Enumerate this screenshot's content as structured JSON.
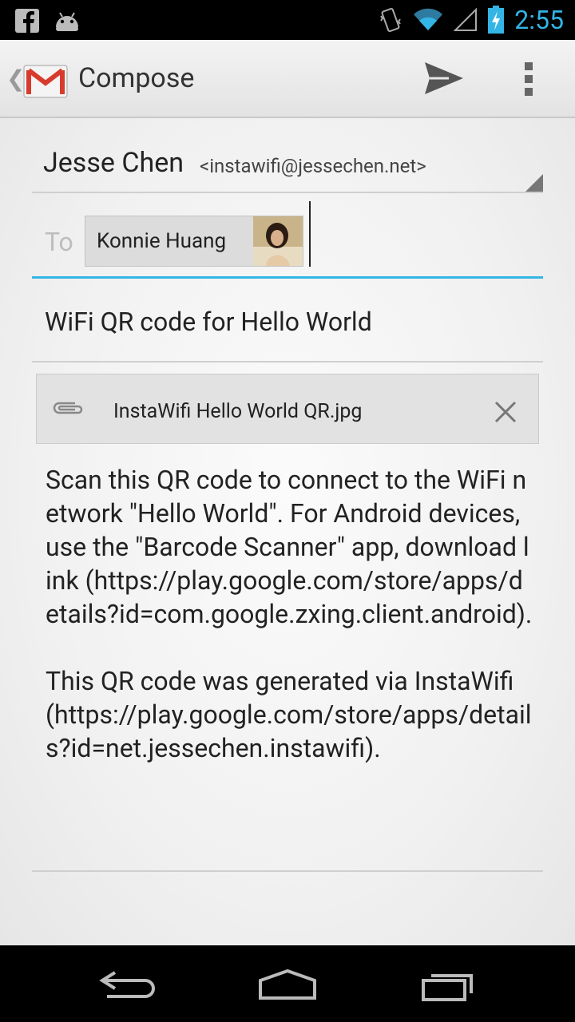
{
  "status_bar": {
    "left_icons": [
      "facebook-icon",
      "android-debug-icon"
    ],
    "right_icons": [
      "vibrate-icon",
      "wifi-icon",
      "signal-icon",
      "battery-charging-icon"
    ],
    "time": "2:55"
  },
  "action_bar": {
    "app_icon": "gmail-icon",
    "title": "Compose",
    "actions": [
      "send-icon",
      "overflow-menu-icon"
    ]
  },
  "compose": {
    "from_name": "Jesse Chen",
    "from_address": "<instawifi@jessechen.net>",
    "to_label": "To",
    "recipient_name": "Konnie Huang",
    "subject": "WiFi QR code for Hello World",
    "attachment_name": "InstaWifi Hello World QR.jpg",
    "body": "Scan this QR code to connect to the WiFi network \"Hello World\". For Android devices, use the \"Barcode Scanner\" app, download link (https://play.google.com/store/apps/details?id=com.google.zxing.client.android).\n\nThis QR code was generated via InstaWifi (https://play.google.com/store/apps/details?id=net.jessechen.instawifi)."
  },
  "colors": {
    "accent": "#33b5e5",
    "gmail_red": "#d83b2d"
  },
  "nav_bar": [
    "back-icon",
    "home-icon",
    "recents-icon"
  ]
}
